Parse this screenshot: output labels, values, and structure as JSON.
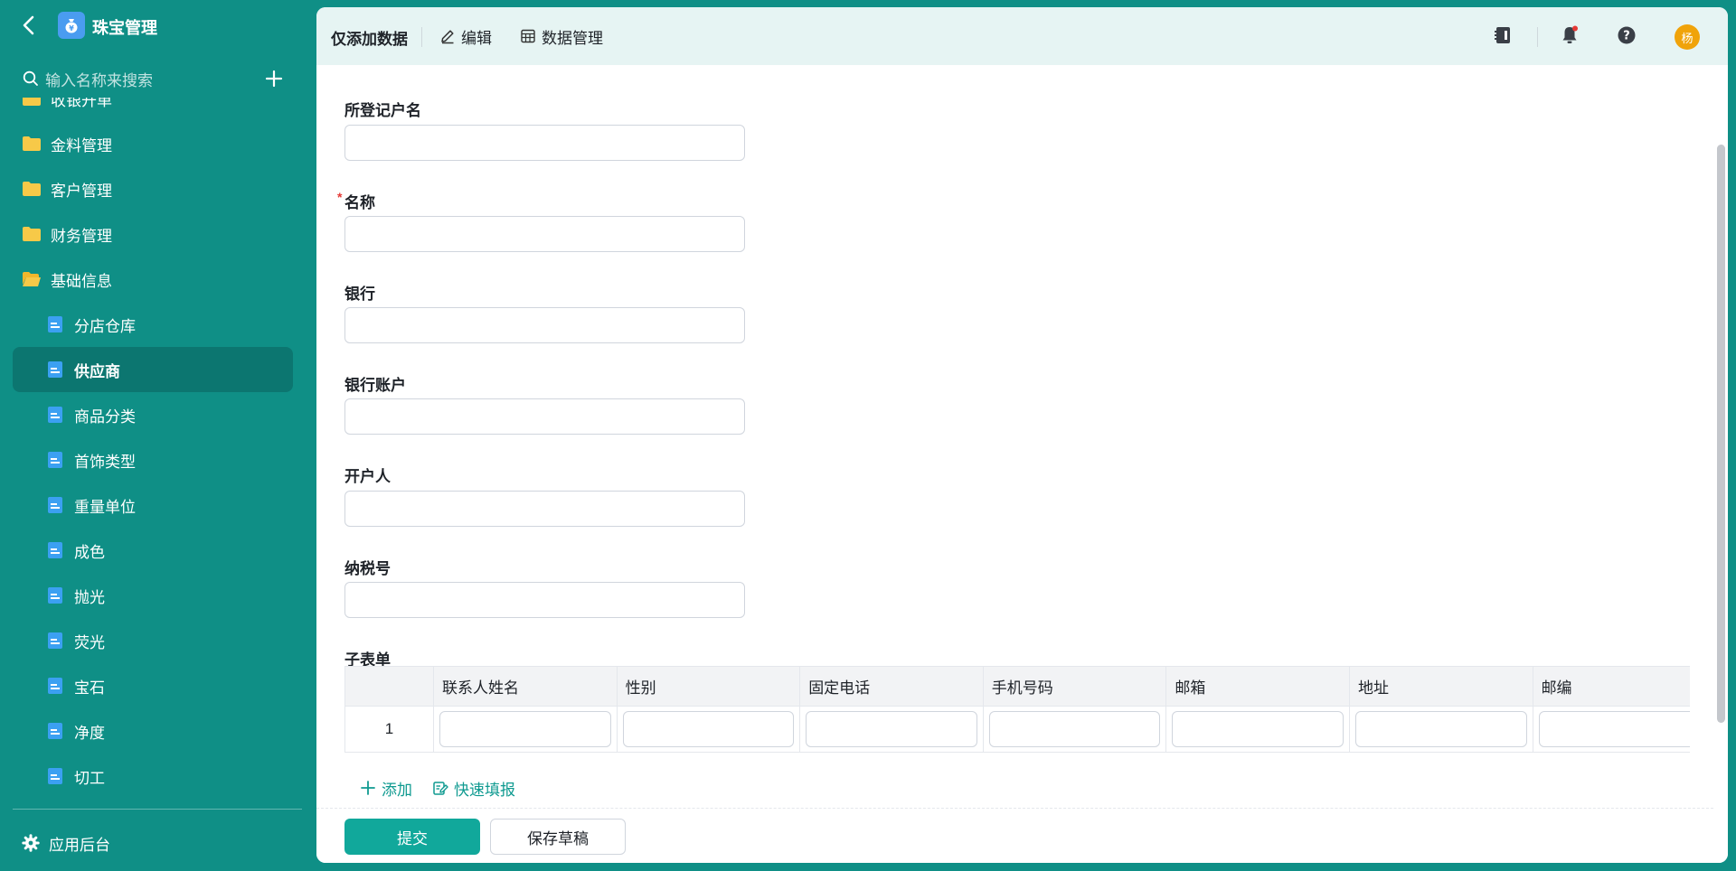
{
  "app": {
    "title": "珠宝管理",
    "logo_icon": "money-bag-icon"
  },
  "sidebar": {
    "search_placeholder": "输入名称来搜索",
    "partial_top_item": "收银开单",
    "folders": [
      {
        "label": "金料管理",
        "icon": "folder-icon"
      },
      {
        "label": "客户管理",
        "icon": "folder-icon"
      },
      {
        "label": "财务管理",
        "icon": "folder-icon"
      },
      {
        "label": "基础信息",
        "icon": "folder-open-icon"
      }
    ],
    "children": [
      {
        "label": "分店仓库"
      },
      {
        "label": "供应商",
        "active": true
      },
      {
        "label": "商品分类"
      },
      {
        "label": "首饰类型"
      },
      {
        "label": "重量单位"
      },
      {
        "label": "成色"
      },
      {
        "label": "抛光"
      },
      {
        "label": "荧光"
      },
      {
        "label": "宝石"
      },
      {
        "label": "净度"
      },
      {
        "label": "切工"
      }
    ],
    "footer_label": "应用后台"
  },
  "topbar": {
    "title": "仅添加数据",
    "edit_label": "编辑",
    "data_manage_label": "数据管理",
    "avatar_text": "杨"
  },
  "form": {
    "fields": [
      {
        "label": "所登记户名",
        "required": false,
        "value": ""
      },
      {
        "label": "名称",
        "required": true,
        "value": ""
      },
      {
        "label": "银行",
        "required": false,
        "value": ""
      },
      {
        "label": "银行账户",
        "required": false,
        "value": ""
      },
      {
        "label": "开户人",
        "required": false,
        "value": ""
      },
      {
        "label": "纳税号",
        "required": false,
        "value": ""
      }
    ],
    "required_mark": "*",
    "subtable": {
      "title": "子表单",
      "columns": [
        "联系人姓名",
        "性别",
        "固定电话",
        "手机号码",
        "邮箱",
        "地址",
        "邮编"
      ],
      "rows": [
        {
          "index": "1",
          "values": [
            "",
            "",
            "",
            "",
            "",
            "",
            ""
          ]
        }
      ],
      "add_label": "添加",
      "quick_fill_label": "快速填报"
    },
    "submit_label": "提交",
    "draft_label": "保存草稿"
  }
}
